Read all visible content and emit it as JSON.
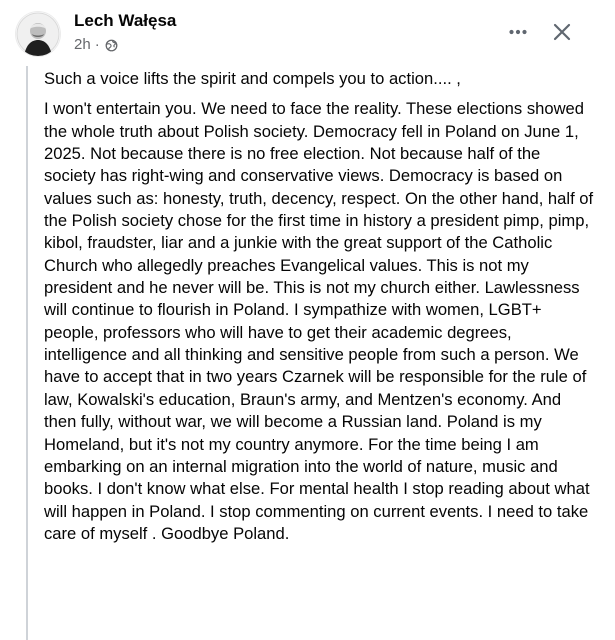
{
  "post": {
    "author": "Lech Wałęsa",
    "time": "2h",
    "separator": "·",
    "audience_icon": "globe-icon",
    "more_icon": "more-dots-icon",
    "close_icon": "close-icon",
    "intro": "Such a voice lifts the spirit and compels you to action.... ,",
    "body": "I won't entertain you. We need to face the reality. These elections showed the whole truth about Polish society. Democracy fell in Poland on June 1, 2025. Not because there is no free election. Not because half of the society has right-wing and conservative views. Democracy is based on values such as: honesty, truth, decency, respect. On the other hand, half of the Polish society chose for the first time in history a president pimp, pimp, kibol, fraudster, liar and a junkie with the great support of the Catholic Church who allegedly preaches Evangelical values. This is not my president and he never will be. This is not my church either. Lawlessness will continue to flourish in Poland. I sympathize with women, LGBT+ people, professors who will have to get their academic degrees, intelligence and all thinking and sensitive people from such a person. We have to accept that in two years Czarnek will be responsible for the rule of law, Kowalski's education, Braun's army, and Mentzen's economy. And then fully, without war, we will become a Russian land. Poland is my Homeland, but it's not my country anymore. For the time being I am embarking on an internal migration into the world of nature, music and books. I don't know what else. For mental health I stop reading about what will happen in Poland. I stop commenting on current events. I need to take care of myself . Goodbye Poland."
  },
  "colors": {
    "text": "#050505",
    "secondary_text": "#65676b",
    "rule": "#cfd3d8",
    "background": "#ffffff"
  }
}
